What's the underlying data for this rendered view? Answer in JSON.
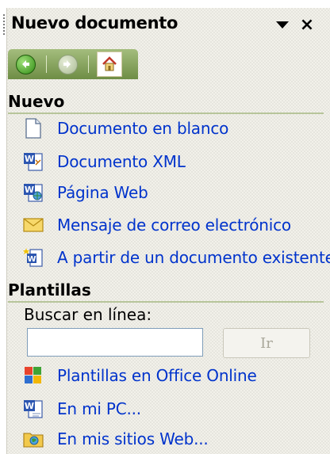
{
  "header": {
    "title": "Nuevo documento",
    "close_glyph": "×"
  },
  "toolbar": {
    "back": "back-arrow-icon",
    "forward": "forward-arrow-icon",
    "home": "home-icon"
  },
  "nuevo": {
    "heading": "Nuevo",
    "items": [
      {
        "label": "Documento en blanco",
        "icon": "blank-document-icon"
      },
      {
        "label": "Documento XML",
        "icon": "word-xml-document-icon"
      },
      {
        "label": "Página Web",
        "icon": "web-page-icon"
      },
      {
        "label": "Mensaje de correo electrónico",
        "icon": "email-envelope-icon"
      },
      {
        "label": "A partir de un documento existente",
        "icon": "existing-document-icon"
      }
    ]
  },
  "plantillas": {
    "heading": "Plantillas",
    "search_label": "Buscar en línea:",
    "search_value": "",
    "go_label": "Ir",
    "items": [
      {
        "label": "Plantillas en Office Online",
        "icon": "office-online-icon"
      },
      {
        "label": "En mi PC...",
        "icon": "word-document-icon"
      },
      {
        "label": "En mis sitios Web...",
        "icon": "web-folder-icon"
      }
    ]
  },
  "colors": {
    "link": "#0033cc",
    "toolbar": "#7a9a4f",
    "rule": "#b7c59a"
  }
}
